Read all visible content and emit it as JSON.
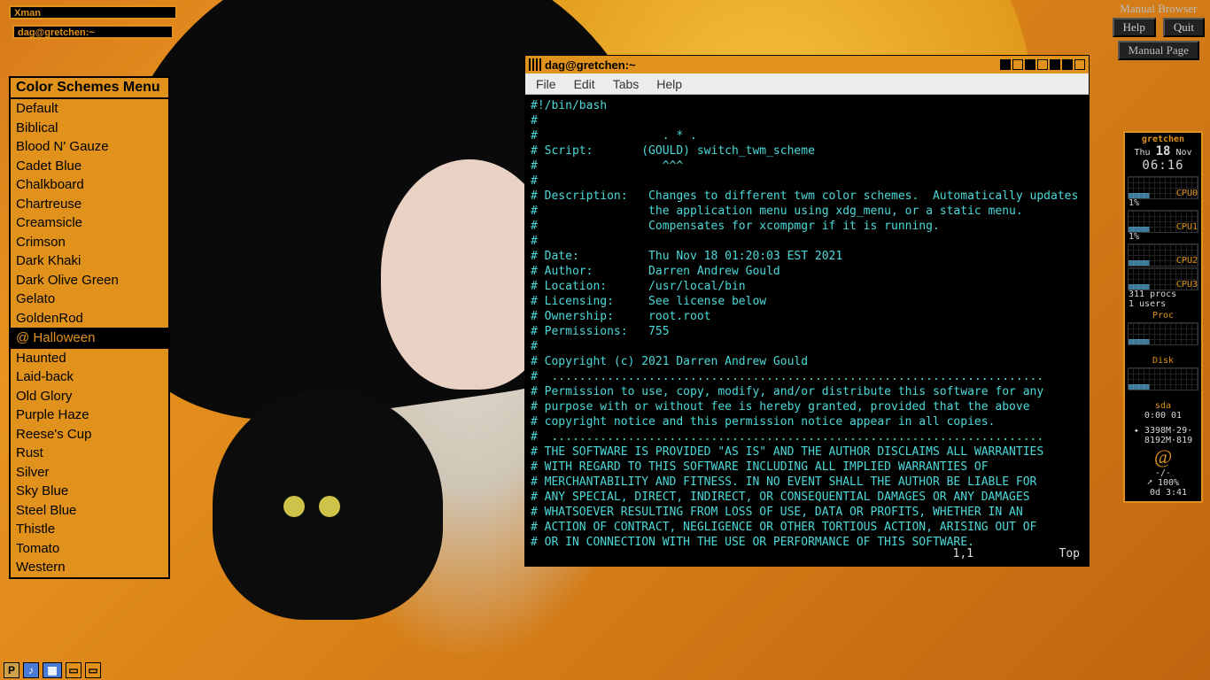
{
  "iconbars": {
    "a": "Xman",
    "b": "dag@gretchen:~"
  },
  "menu": {
    "title": "Color Schemes Menu",
    "items": [
      "Default",
      "Biblical",
      "Blood N' Gauze",
      "Cadet Blue",
      "Chalkboard",
      "Chartreuse",
      "Creamsicle",
      "Crimson",
      "Dark Khaki",
      "Dark Olive Green",
      "Gelato",
      "GoldenRod",
      "@ Halloween",
      "Haunted",
      "Laid-back",
      "Old Glory",
      "Purple Haze",
      "Reese's Cup",
      "Rust",
      "Silver",
      "Sky Blue",
      "Steel Blue",
      "Thistle",
      "Tomato",
      "Western"
    ],
    "selected": "@ Halloween"
  },
  "terminal": {
    "title": "dag@gretchen:~",
    "menus": [
      "File",
      "Edit",
      "Tabs",
      "Help"
    ],
    "body": "#!/bin/bash\n#\n#                  . * .\n# Script:       (GOULD) switch_twm_scheme\n#                  ^^^\n#\n# Description:   Changes to different twm color schemes.  Automatically updates\n#                the application menu using xdg_menu, or a static menu.\n#                Compensates for xcompmgr if it is running.\n#\n# Date:          Thu Nov 18 01:20:03 EST 2021\n# Author:        Darren Andrew Gould\n# Location:      /usr/local/bin\n# Licensing:     See license below\n# Ownership:     root.root\n# Permissions:   755\n#\n# Copyright (c) 2021 Darren Andrew Gould\n#  .......................................................................\n# Permission to use, copy, modify, and/or distribute this software for any\n# purpose with or without fee is hereby granted, provided that the above\n# copyright notice and this permission notice appear in all copies.\n#  .......................................................................\n# THE SOFTWARE IS PROVIDED \"AS IS\" AND THE AUTHOR DISCLAIMS ALL WARRANTIES\n# WITH REGARD TO THIS SOFTWARE INCLUDING ALL IMPLIED WARRANTIES OF\n# MERCHANTABILITY AND FITNESS. IN NO EVENT SHALL THE AUTHOR BE LIABLE FOR\n# ANY SPECIAL, DIRECT, INDIRECT, OR CONSEQUENTIAL DAMAGES OR ANY DAMAGES\n# WHATSOEVER RESULTING FROM LOSS OF USE, DATA OR PROFITS, WHETHER IN AN\n# ACTION OF CONTRACT, NEGLIGENCE OR OTHER TORTIOUS ACTION, ARISING OUT OF\n# OR IN CONNECTION WITH THE USE OR PERFORMANCE OF THIS SOFTWARE.",
    "status_pos": "1,1",
    "status_scroll": "Top"
  },
  "xman": {
    "title": "Manual Browser",
    "help": "Help",
    "quit": "Quit",
    "page": "Manual Page"
  },
  "conky": {
    "host": "gretchen",
    "date_pre": "Thu ",
    "date_day": "18",
    "date_post": " Nov",
    "clock": "06:16",
    "cpus": [
      {
        "label": "CPU0",
        "val": "1%"
      },
      {
        "label": "CPU1",
        "val": "1%"
      },
      {
        "label": "CPU2",
        "val": ""
      },
      {
        "label": "CPU3",
        "val": ""
      }
    ],
    "procs": "311 procs",
    "users": "1 users",
    "sect_proc": "Proc",
    "sect_disk": "Disk",
    "sda_label": "sda",
    "sda_val": "0:00 01",
    "mem1": "3398M·29·",
    "mem2": "8192M·819",
    "net_rate": "-/-",
    "net_pct": "100%",
    "uptime": "0d 3:41"
  },
  "taskbar": {
    "p": "P"
  }
}
